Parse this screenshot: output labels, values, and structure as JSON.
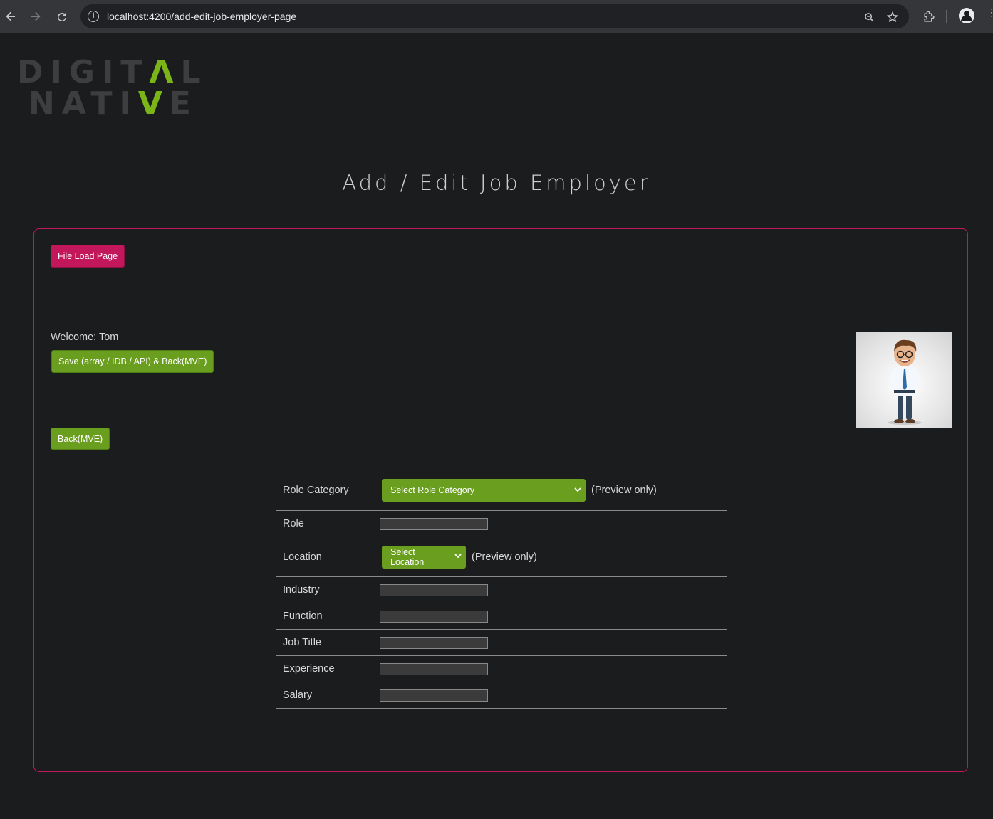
{
  "browser": {
    "url": "localhost:4200/add-edit-job-employer-page"
  },
  "logo": {
    "line1_a": "DIGIT",
    "line1_accent": "Λ",
    "line1_b": "L",
    "line2_a": "NATI",
    "line2_accent": "V",
    "line2_b": "E"
  },
  "page": {
    "title": "Add / Edit Job Employer"
  },
  "actions": {
    "file_load_label": "File Load Page",
    "welcome_text": "Welcome: Tom",
    "save_label": "Save (array / IDB / API) & Back(MVE)",
    "back_label": "Back(MVE)"
  },
  "form": {
    "role_category": {
      "label": "Role Category",
      "select_value": "Select Role Category",
      "note": "(Preview only)"
    },
    "role": {
      "label": "Role",
      "value": ""
    },
    "location": {
      "label": "Location",
      "select_value": "Select Location",
      "note": "(Preview only)"
    },
    "industry": {
      "label": "Industry",
      "value": ""
    },
    "function": {
      "label": "Function",
      "value": ""
    },
    "job_title": {
      "label": "Job Title",
      "value": ""
    },
    "experience": {
      "label": "Experience",
      "value": ""
    },
    "salary": {
      "label": "Salary",
      "value": ""
    }
  },
  "colors": {
    "accent_green": "#6a9e1f",
    "accent_pink": "#c2185b",
    "background": "#1b1c1e"
  },
  "icons": [
    "back-arrow-icon",
    "forward-arrow-icon",
    "reload-icon",
    "site-info-icon",
    "zoom-icon",
    "bookmark-star-icon",
    "extensions-icon",
    "profile-avatar-icon",
    "menu-dots-icon",
    "chevron-down-icon"
  ]
}
